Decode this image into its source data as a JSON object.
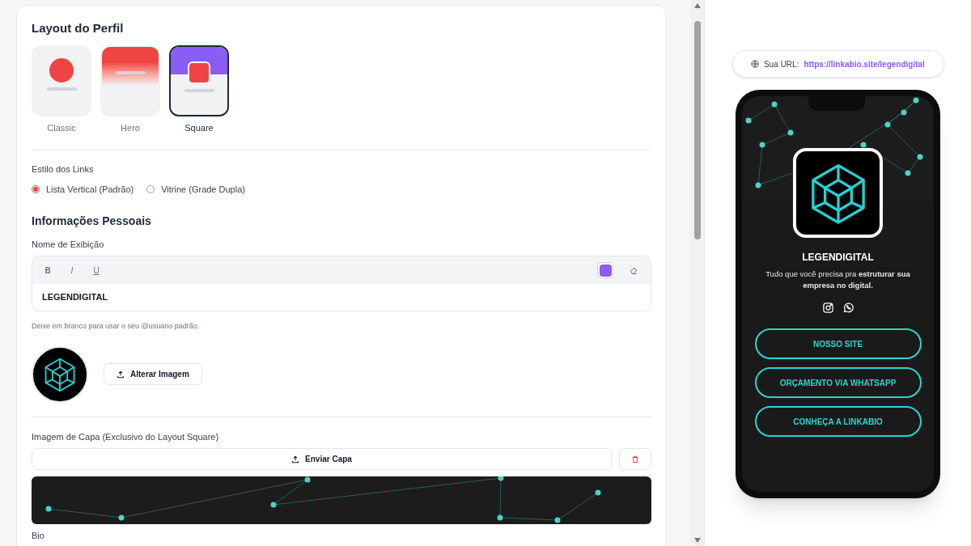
{
  "layout_section": {
    "title": "Layout do Perfil",
    "options": [
      {
        "kind": "classic",
        "label": "Classic",
        "selected": false
      },
      {
        "kind": "hero",
        "label": "Hero",
        "selected": false
      },
      {
        "kind": "square",
        "label": "Square",
        "selected": true
      }
    ]
  },
  "link_style": {
    "label": "Estilo dos Links",
    "options": [
      {
        "label": "Lista Vertical (Padrão)",
        "selected": true
      },
      {
        "label": "Vitrine (Grade Dupla)",
        "selected": false
      }
    ]
  },
  "personal_info": {
    "title": "Informações Pessoais",
    "display_name": {
      "label": "Nome de Exibição",
      "toolbar": [
        "B",
        "I",
        "U"
      ],
      "color": "#8b5cf6",
      "value": "LEGENDIGITAL"
    },
    "hint": "Deixe em branco para usar o seu @usuario padrão.",
    "change_image_button": "Alterar Imagem"
  },
  "cover": {
    "label": "Imagem de Capa (Exclusivo do Layout Square)",
    "upload_button": "Enviar Capa"
  },
  "bio": {
    "label": "Bio"
  },
  "preview": {
    "url_label": "Sua URL:",
    "url": "https://linkabio.site/legendigital",
    "name": "LEGENDIGITAL",
    "bio": "Tudo que você precisa pra **estruturar sua empresa no digital.**",
    "links": [
      "NOSSO SITE",
      "ORÇAMENTO VIA WHATSAPP",
      "CONHEÇA A LINKABIO"
    ]
  }
}
